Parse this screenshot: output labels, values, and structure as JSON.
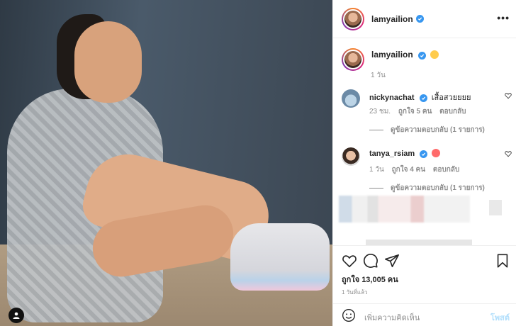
{
  "post": {
    "username": "lamyailion",
    "more_icon": "•••"
  },
  "caption": {
    "username": "lamyailion",
    "time": "1 วัน"
  },
  "comments": [
    {
      "username": "nickynachat",
      "text": "เสื้อสวยยยย",
      "time": "23 ชม.",
      "likes": "ถูกใจ 5 คน",
      "reply": "ตอบกลับ",
      "view_replies": "ดูข้อความตอบกลับ (1 รายการ)"
    },
    {
      "username": "tanya_rsiam",
      "text": "",
      "time": "1 วัน",
      "likes": "ถูกใจ 4 คน",
      "reply": "ตอบกลับ",
      "view_replies": "ดูข้อความตอบกลับ (1 รายการ)"
    }
  ],
  "actions": {
    "likes_text": "ถูกใจ 13,005 คน",
    "post_time": "1 วันที่แล้ว"
  },
  "add_comment": {
    "placeholder": "เพิ่มความคิดเห็น",
    "post_label": "โพสต์"
  },
  "colors": {
    "verified": "#3897f0",
    "muted": "#8e8e8e",
    "post_disabled": "#b2dffc"
  }
}
